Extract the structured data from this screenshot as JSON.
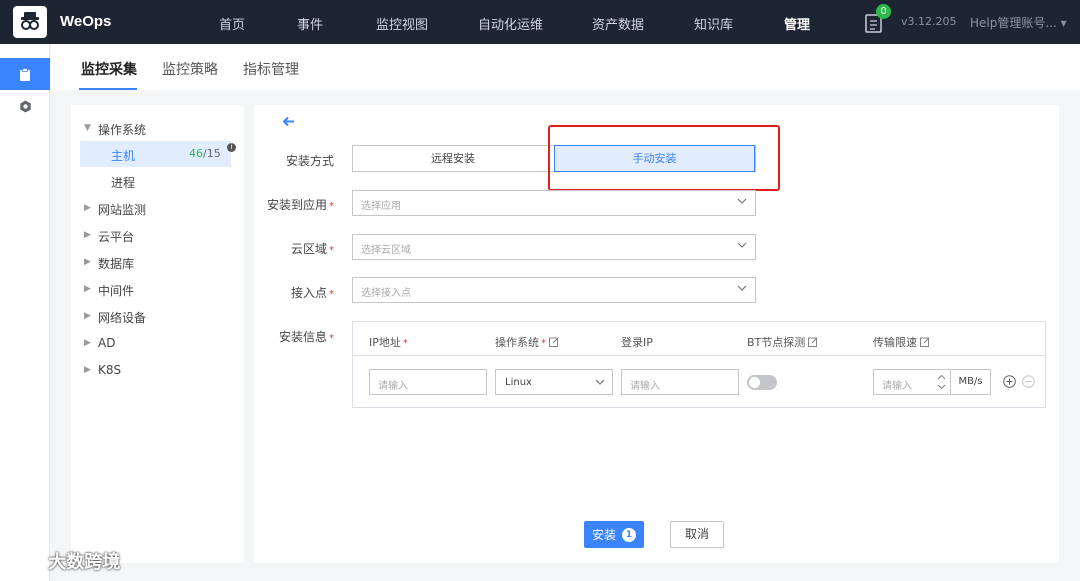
{
  "topnav": {
    "brand": "WeOps",
    "items": [
      "首页",
      "事件",
      "监控视图",
      "自动化运维",
      "资产数据",
      "知识库",
      "管理"
    ],
    "active": "管理",
    "notification_count": "0",
    "version": "v3.12.205",
    "user": "Help管理账号... ▾"
  },
  "subnav": {
    "tabs": [
      "监控采集",
      "监控策略",
      "指标管理"
    ],
    "active": "监控采集"
  },
  "tree": {
    "items": [
      {
        "label": "操作系统",
        "expanded": true
      },
      {
        "label": "主机",
        "child": true,
        "selected": true,
        "count_ok": "46",
        "count_total": "/15"
      },
      {
        "label": "进程",
        "child": true
      },
      {
        "label": "网站监测"
      },
      {
        "label": "云平台"
      },
      {
        "label": "数据库"
      },
      {
        "label": "中间件"
      },
      {
        "label": "网络设备"
      },
      {
        "label": "AD"
      },
      {
        "label": "K8S"
      }
    ]
  },
  "form": {
    "install_mode_label": "安装方式",
    "install_mode_options": [
      "远程安装",
      "手动安装"
    ],
    "install_mode_selected": "手动安装",
    "app_label": "安装到应用",
    "app_placeholder": "选择应用",
    "region_label": "云区域",
    "region_placeholder": "选择云区域",
    "access_label": "接入点",
    "access_placeholder": "选择接入点",
    "info_label": "安装信息",
    "required_mark": "*",
    "table": {
      "headers": {
        "ip": "IP地址",
        "os": "操作系统",
        "login_ip": "登录IP",
        "bt": "BT节点探测",
        "speed": "传输限速"
      },
      "row": {
        "ip_placeholder": "请输入",
        "os_value": "Linux",
        "login_ip_placeholder": "请输入",
        "bt_enabled": false,
        "speed_placeholder": "请输入",
        "speed_unit": "MB/s"
      }
    },
    "submit_label": "安装",
    "submit_badge": "1",
    "cancel_label": "取消"
  },
  "watermark": "大数跨境",
  "colors": {
    "primary": "#3a84ff",
    "nav_bg": "#1e2532",
    "highlight": "#e02020",
    "success": "#2db84d"
  }
}
